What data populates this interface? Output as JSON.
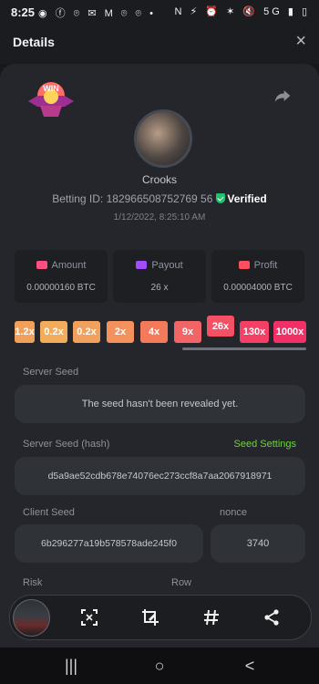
{
  "status_bar": {
    "time": "8:25",
    "right": "5G"
  },
  "header": {
    "title": "Details",
    "close_icon": "×"
  },
  "profile": {
    "username": "Crooks",
    "betting_id_prefix": "Betting ID: ",
    "betting_id": "182966508752769 56",
    "verified_label": "Verified",
    "timestamp": "1/12/2022, 8:25:10 AM",
    "badge_text": "WIN"
  },
  "stats": [
    {
      "label": "Amount",
      "value": "0.00000160 BTC",
      "icon": "amount-icon",
      "color": "#ff4f81"
    },
    {
      "label": "Payout",
      "value": "26 x",
      "icon": "payout-icon",
      "color": "#a34cff"
    },
    {
      "label": "Profit",
      "value": "0.00004000 BTC",
      "icon": "profit-icon",
      "color": "#ff4f5f"
    }
  ],
  "multipliers": [
    {
      "label": "1.2x",
      "color": "#f0a05a"
    },
    {
      "label": "0.2x",
      "color": "#f3ac5c"
    },
    {
      "label": "0.2x",
      "color": "#f1a15d"
    },
    {
      "label": "2x",
      "color": "#f3925c"
    },
    {
      "label": "4x",
      "color": "#f37a5b"
    },
    {
      "label": "9x",
      "color": "#f16566"
    },
    {
      "label": "26x",
      "color": "#f55064"
    },
    {
      "label": "130x",
      "color": "#f44065"
    },
    {
      "label": "1000x",
      "color": "#f03066"
    }
  ],
  "fields": {
    "server_seed_label": "Server Seed",
    "server_seed_value": "The seed hasn't been revealed yet.",
    "server_hash_label": "Server Seed (hash)",
    "seed_settings": "Seed Settings",
    "server_hash_value": "d5a9ae52cdb678e74076ec273ccf8a7aa2067918971",
    "client_seed_label": "Client Seed",
    "client_seed_value": "6b296277a19b578578ade245f0",
    "nonce_label": "nonce",
    "nonce_value": "3740",
    "risk_label": "Risk",
    "row_label": "Row"
  },
  "bottom_icons": [
    "scan-icon",
    "edit-icon",
    "hash-icon",
    "share-icon"
  ],
  "nav": {
    "recent": "|||",
    "home": "○",
    "back": "<"
  }
}
